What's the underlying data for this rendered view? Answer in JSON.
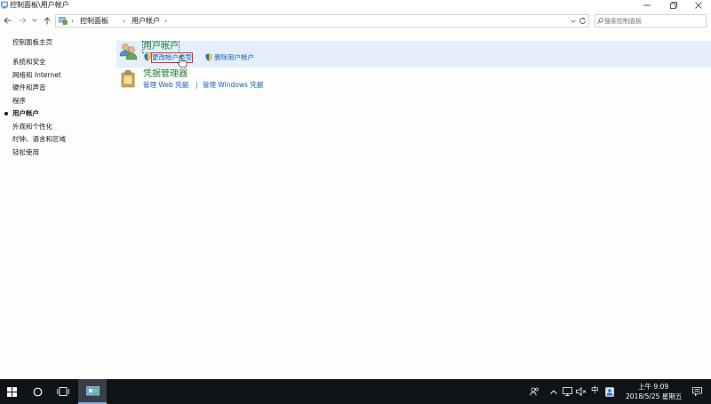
{
  "window": {
    "title": "控制面板\\用户帐户"
  },
  "address": {
    "crumbs": [
      "控制面板",
      "用户帐户"
    ]
  },
  "search": {
    "placeholder": "搜索控制面板"
  },
  "sidebar": {
    "items": [
      {
        "label": "控制面板主页"
      },
      {
        "label": "系统和安全"
      },
      {
        "label": "网络和 Internet"
      },
      {
        "label": "硬件和声音"
      },
      {
        "label": "程序"
      },
      {
        "label": "用户帐户",
        "selected": true
      },
      {
        "label": "外观和个性化"
      },
      {
        "label": "时钟、语言和区域"
      },
      {
        "label": "轻松使用"
      }
    ]
  },
  "categories": {
    "user_accounts": {
      "title": "用户帐户",
      "links": [
        "更改帐户类型",
        "删除用户帐户"
      ]
    },
    "credential_manager": {
      "title": "凭据管理器",
      "links": [
        "管理 Web 凭据",
        "管理 Windows 凭据"
      ]
    }
  },
  "taskbar": {
    "ime": "中",
    "time": "上午 9:09",
    "date": "2018/5/25 星期五"
  },
  "colors": {
    "accent_link": "#1a5fb4",
    "category_title": "#1e7a3c",
    "selection_bg": "#e4effb",
    "taskbar_bg": "#101418"
  }
}
